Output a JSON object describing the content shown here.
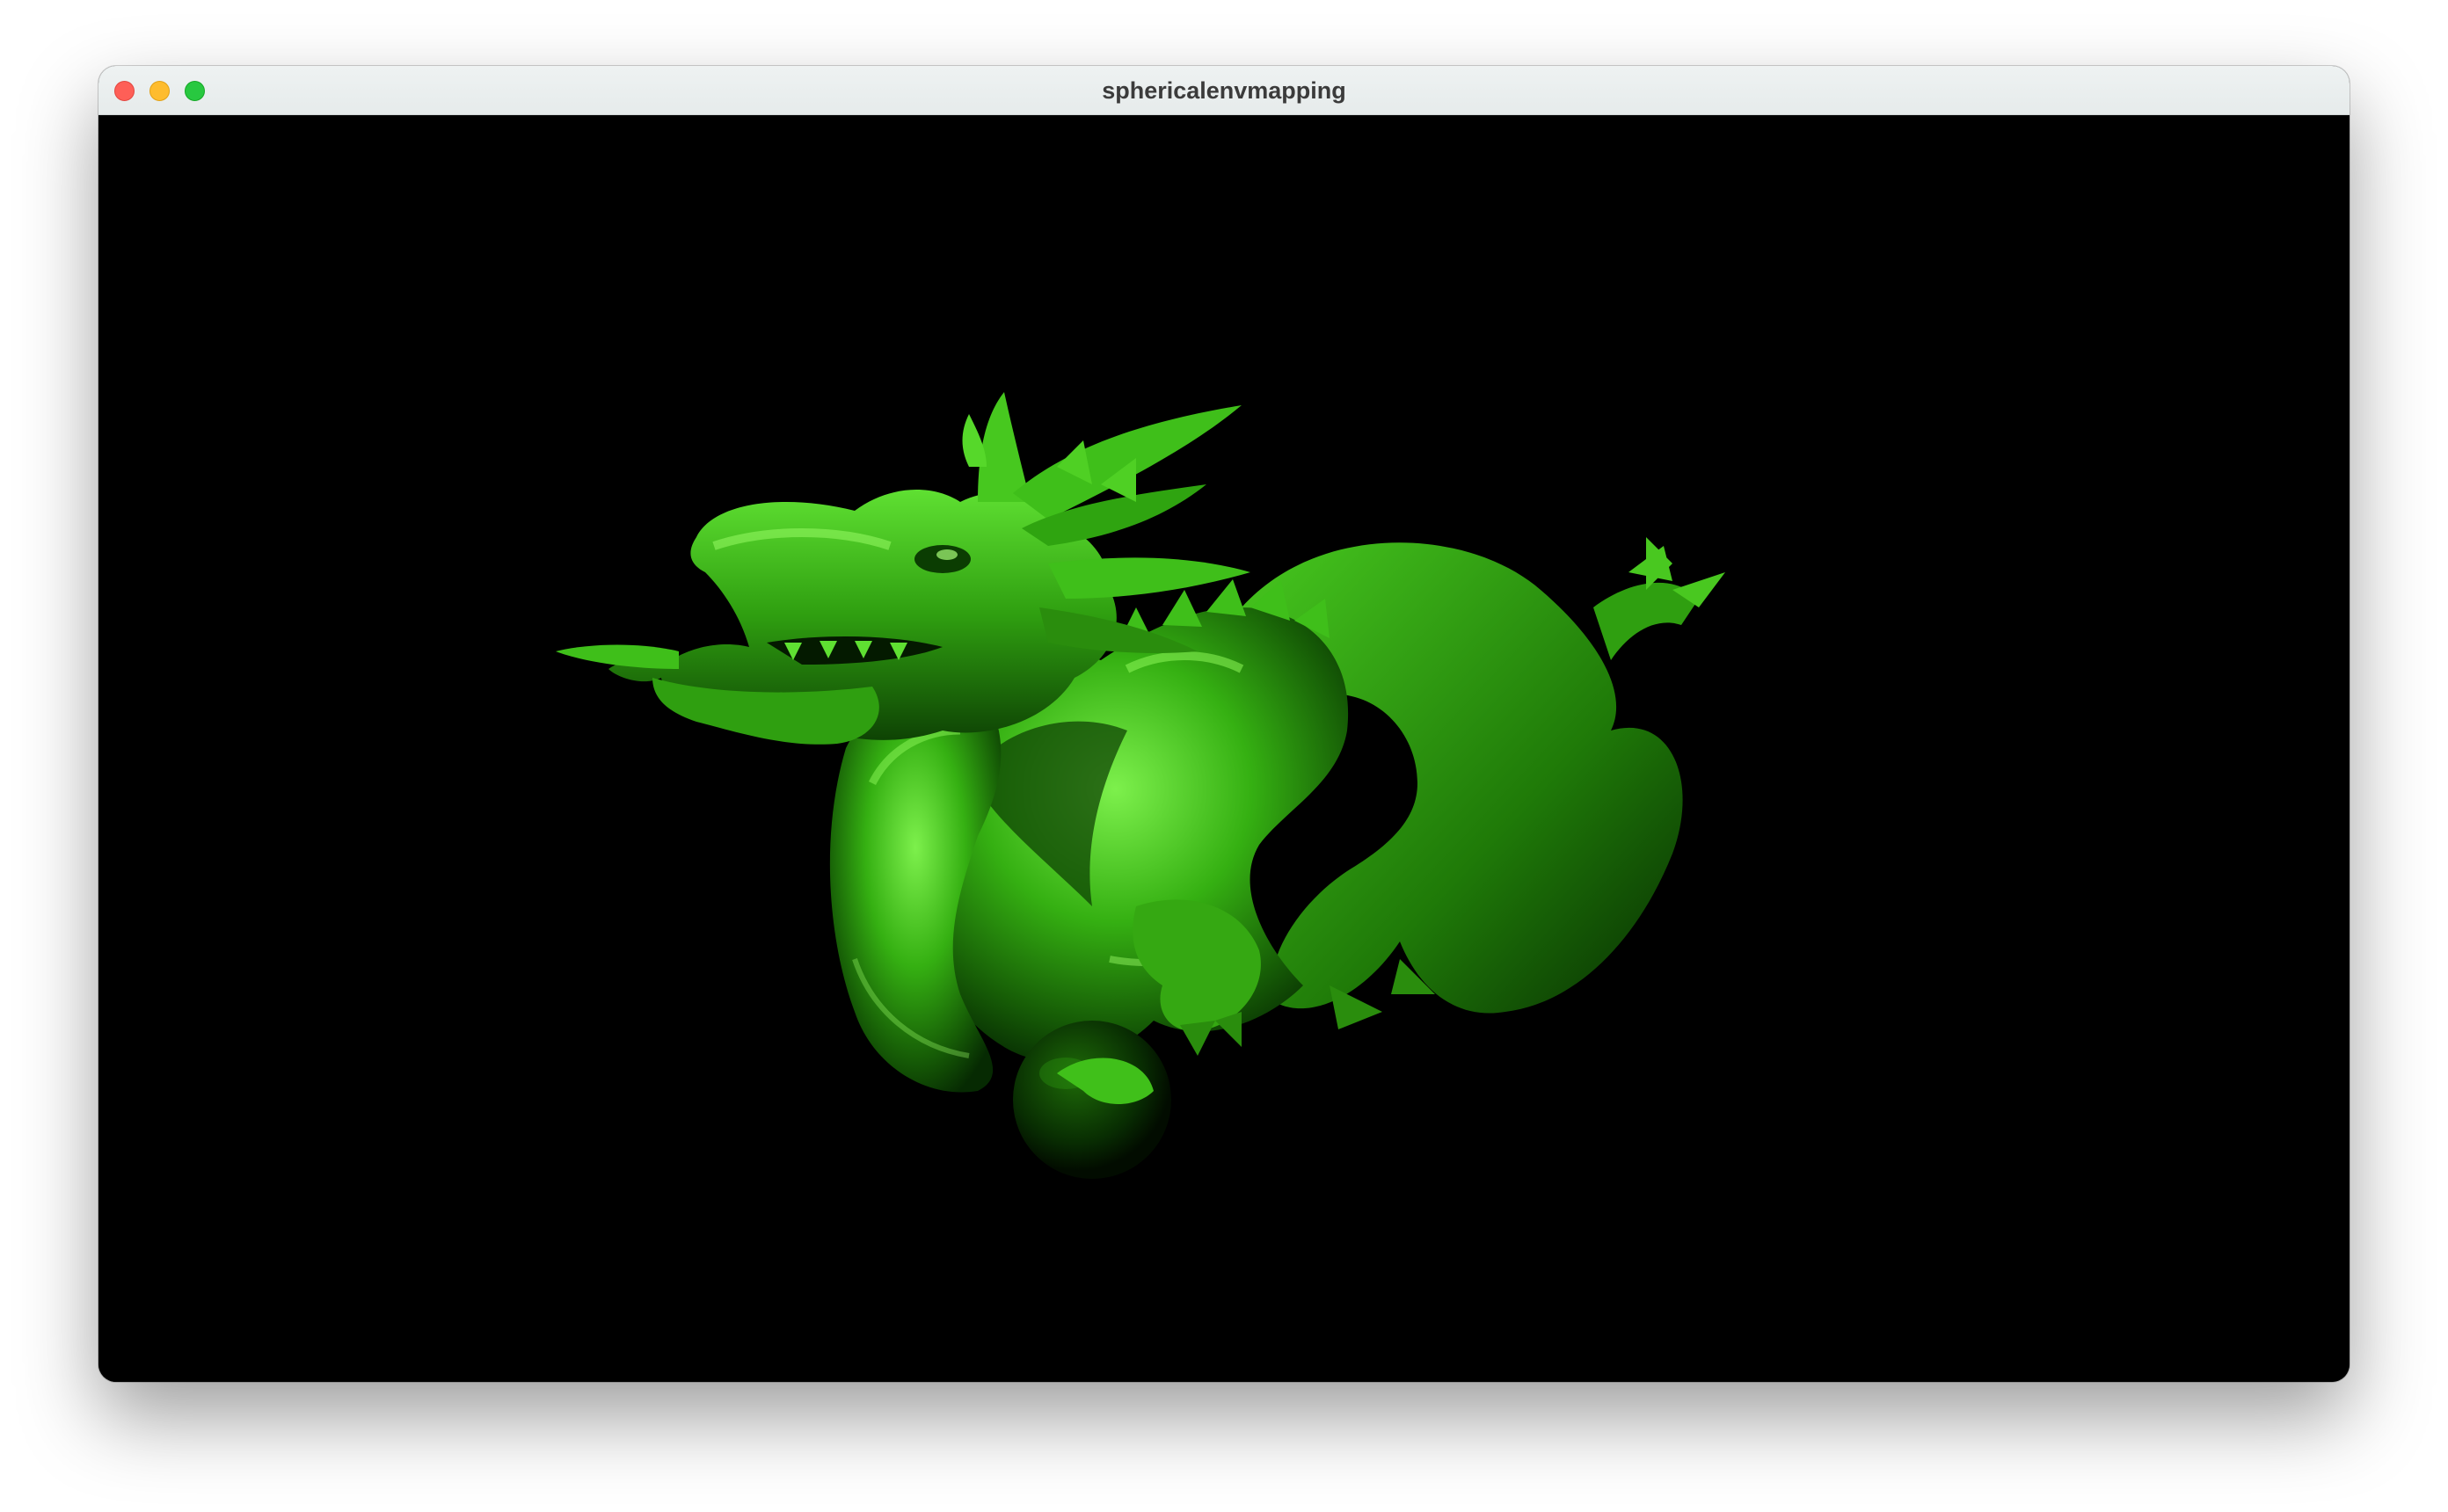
{
  "window": {
    "title": "sphericalenvmapping"
  },
  "viewport": {
    "background": "#000000",
    "model": "dragon-model",
    "material_color": "#3fbf1a"
  }
}
